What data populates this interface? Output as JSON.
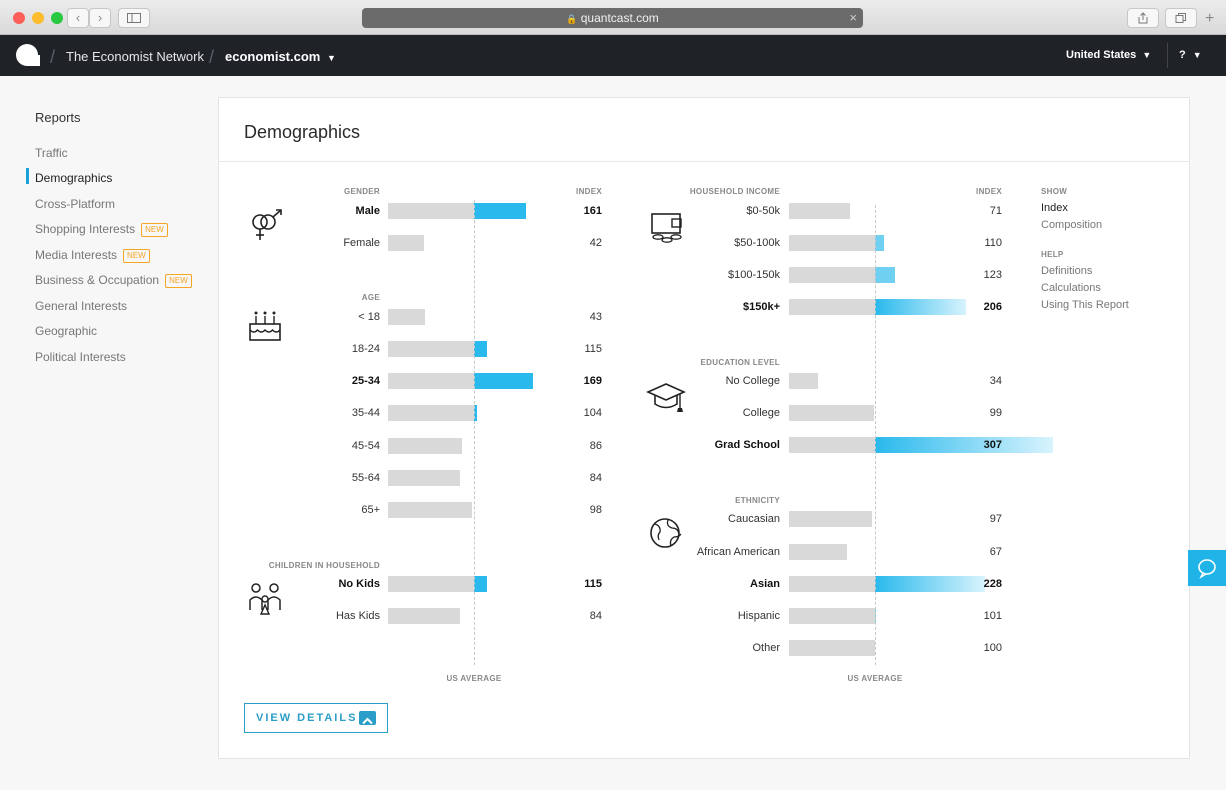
{
  "browser": {
    "url": "quantcast.com",
    "back": "‹",
    "forward": "›",
    "close": "×"
  },
  "appbar": {
    "network": "The Economist Network",
    "site": "economist.com",
    "country": "United States",
    "help": "?",
    "caret": "▼"
  },
  "sidebar": {
    "title": "Reports",
    "items": [
      {
        "label": "Traffic"
      },
      {
        "label": "Demographics"
      },
      {
        "label": "Cross-Platform"
      },
      {
        "label": "Shopping Interests",
        "badge": "NEW"
      },
      {
        "label": "Media Interests",
        "badge": "NEW"
      },
      {
        "label": "Business & Occupation",
        "badge": "NEW"
      },
      {
        "label": "General Interests"
      },
      {
        "label": "Geographic"
      },
      {
        "label": "Political Interests"
      }
    ]
  },
  "card": {
    "title": "Demographics",
    "index_header": "INDEX",
    "us_average": "US AVERAGE",
    "view_details": "VIEW DETAILS"
  },
  "left_sections": [
    {
      "title": "GENDER",
      "rows": [
        {
          "label": "Male",
          "index": 161,
          "bold": true
        },
        {
          "label": "Female",
          "index": 42
        }
      ]
    },
    {
      "title": "AGE",
      "rows": [
        {
          "label": "< 18",
          "index": 43
        },
        {
          "label": "18-24",
          "index": 115
        },
        {
          "label": "25-34",
          "index": 169,
          "bold": true
        },
        {
          "label": "35-44",
          "index": 104
        },
        {
          "label": "45-54",
          "index": 86
        },
        {
          "label": "55-64",
          "index": 84
        },
        {
          "label": "65+",
          "index": 98
        }
      ]
    },
    {
      "title": "CHILDREN IN HOUSEHOLD",
      "rows": [
        {
          "label": "No Kids",
          "index": 115,
          "bold": true
        },
        {
          "label": "Has Kids",
          "index": 84
        }
      ]
    }
  ],
  "right_sections": [
    {
      "title": "HOUSEHOLD INCOME",
      "rows": [
        {
          "label": "$0-50k",
          "index": 71
        },
        {
          "label": "$50-100k",
          "index": 110
        },
        {
          "label": "$100-150k",
          "index": 123
        },
        {
          "label": "$150k+",
          "index": 206,
          "bold": true
        }
      ]
    },
    {
      "title": "EDUCATION LEVEL",
      "rows": [
        {
          "label": "No College",
          "index": 34
        },
        {
          "label": "College",
          "index": 99
        },
        {
          "label": "Grad School",
          "index": 307,
          "bold": true
        }
      ]
    },
    {
      "title": "ETHNICITY",
      "rows": [
        {
          "label": "Caucasian",
          "index": 97
        },
        {
          "label": "African American",
          "index": 67
        },
        {
          "label": "Asian",
          "index": 228,
          "bold": true
        },
        {
          "label": "Hispanic",
          "index": 101
        },
        {
          "label": "Other",
          "index": 100
        }
      ]
    }
  ],
  "show": {
    "title": "SHOW",
    "items": [
      {
        "label": "Index",
        "active": true
      },
      {
        "label": "Composition"
      }
    ]
  },
  "help": {
    "title": "HELP",
    "items": [
      {
        "label": "Definitions"
      },
      {
        "label": "Calculations"
      },
      {
        "label": "Using This Report"
      }
    ]
  }
}
